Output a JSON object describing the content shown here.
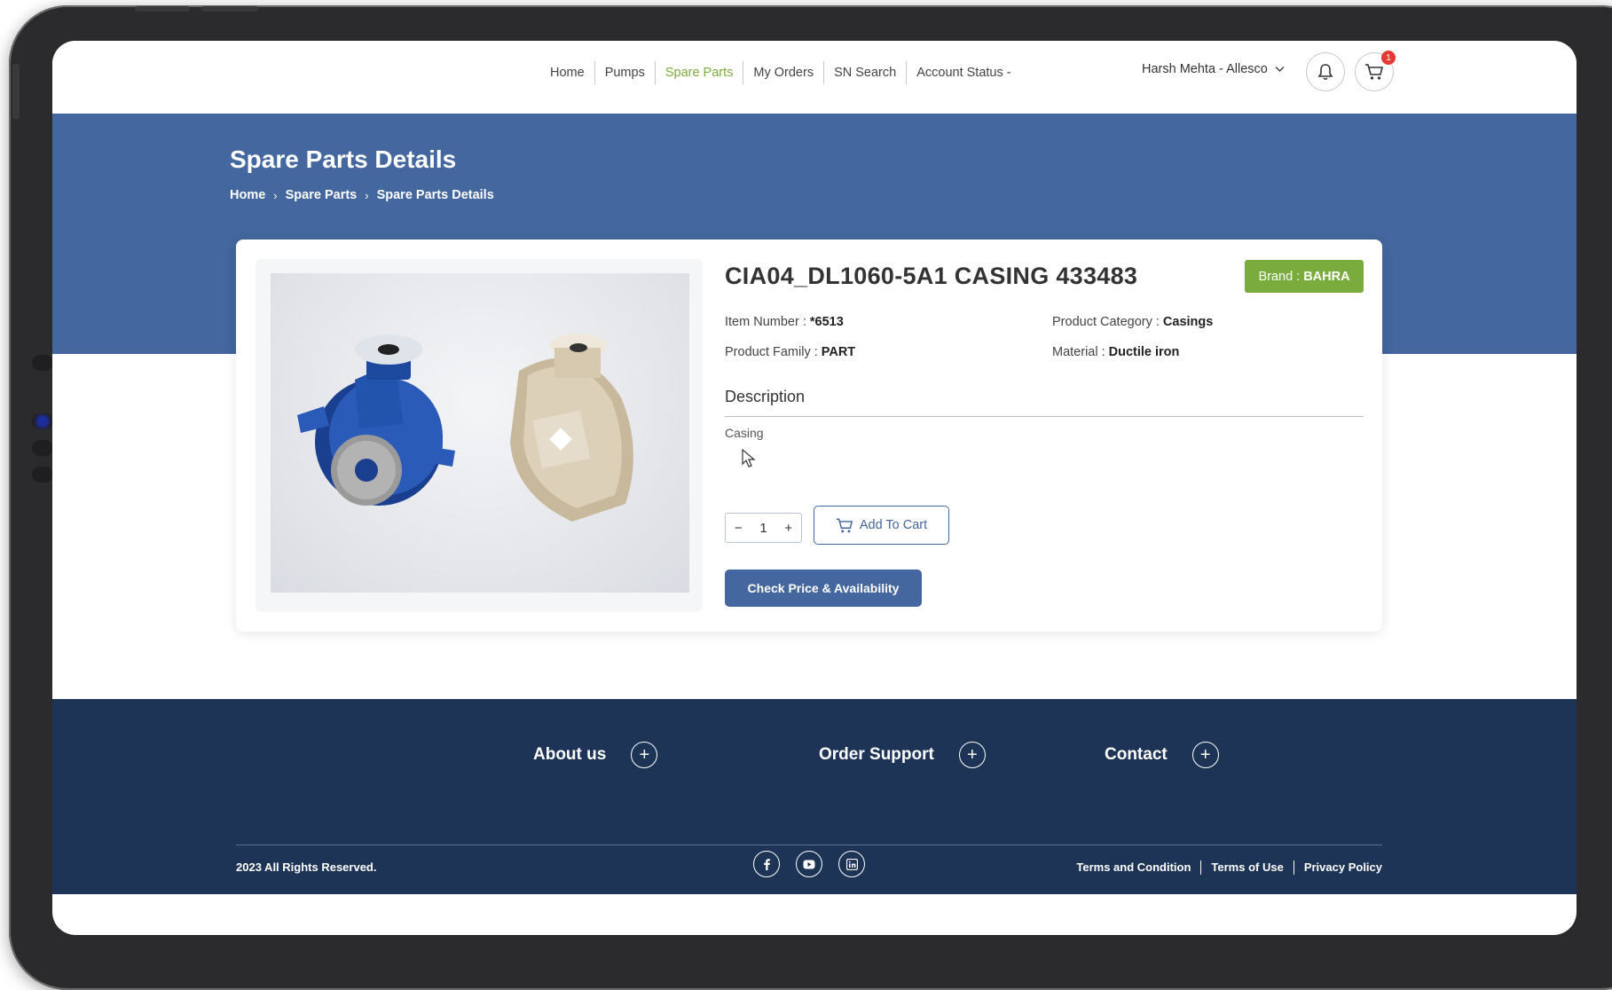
{
  "nav": {
    "links": [
      "Home",
      "Pumps",
      "Spare Parts",
      "My Orders",
      "SN Search",
      "Account Status -"
    ],
    "active": "Spare Parts",
    "user": "Harsh Mehta - Allesco",
    "cart_count": "1"
  },
  "hero": {
    "title": "Spare Parts Details",
    "breadcrumb": [
      "Home",
      "Spare Parts",
      "Spare Parts Details"
    ],
    "separator": "›"
  },
  "product": {
    "title": "CIA04_DL1060-5A1 CASING 433483",
    "brand_label": "Brand :",
    "brand_value": "BAHRA",
    "item_number_label": "Item Number :",
    "item_number": "*6513",
    "category_label": "Product Category :",
    "category": "Casings",
    "family_label": "Product Family :",
    "family": "PART",
    "material_label": "Material :",
    "material": "Ductile iron",
    "description_heading": "Description",
    "description": "Casing",
    "quantity": "1",
    "qty_minus": "−",
    "qty_plus": "+",
    "add_to_cart": "Add To Cart",
    "check_price": "Check Price & Availability"
  },
  "footer": {
    "sections": [
      "About us",
      "Order Support",
      "Contact"
    ],
    "plus_symbol": "+",
    "copyright": "2023 All Rights Reserved.",
    "social": [
      "facebook-icon",
      "youtube-icon",
      "linkedin-icon"
    ],
    "legal": [
      "Terms and Condition",
      "Terms of Use",
      "Privacy Policy"
    ]
  },
  "colors": {
    "primary": "#43679e",
    "footer": "#1e3457",
    "accent_green": "#7aac3d",
    "badge_red": "#e53935"
  }
}
